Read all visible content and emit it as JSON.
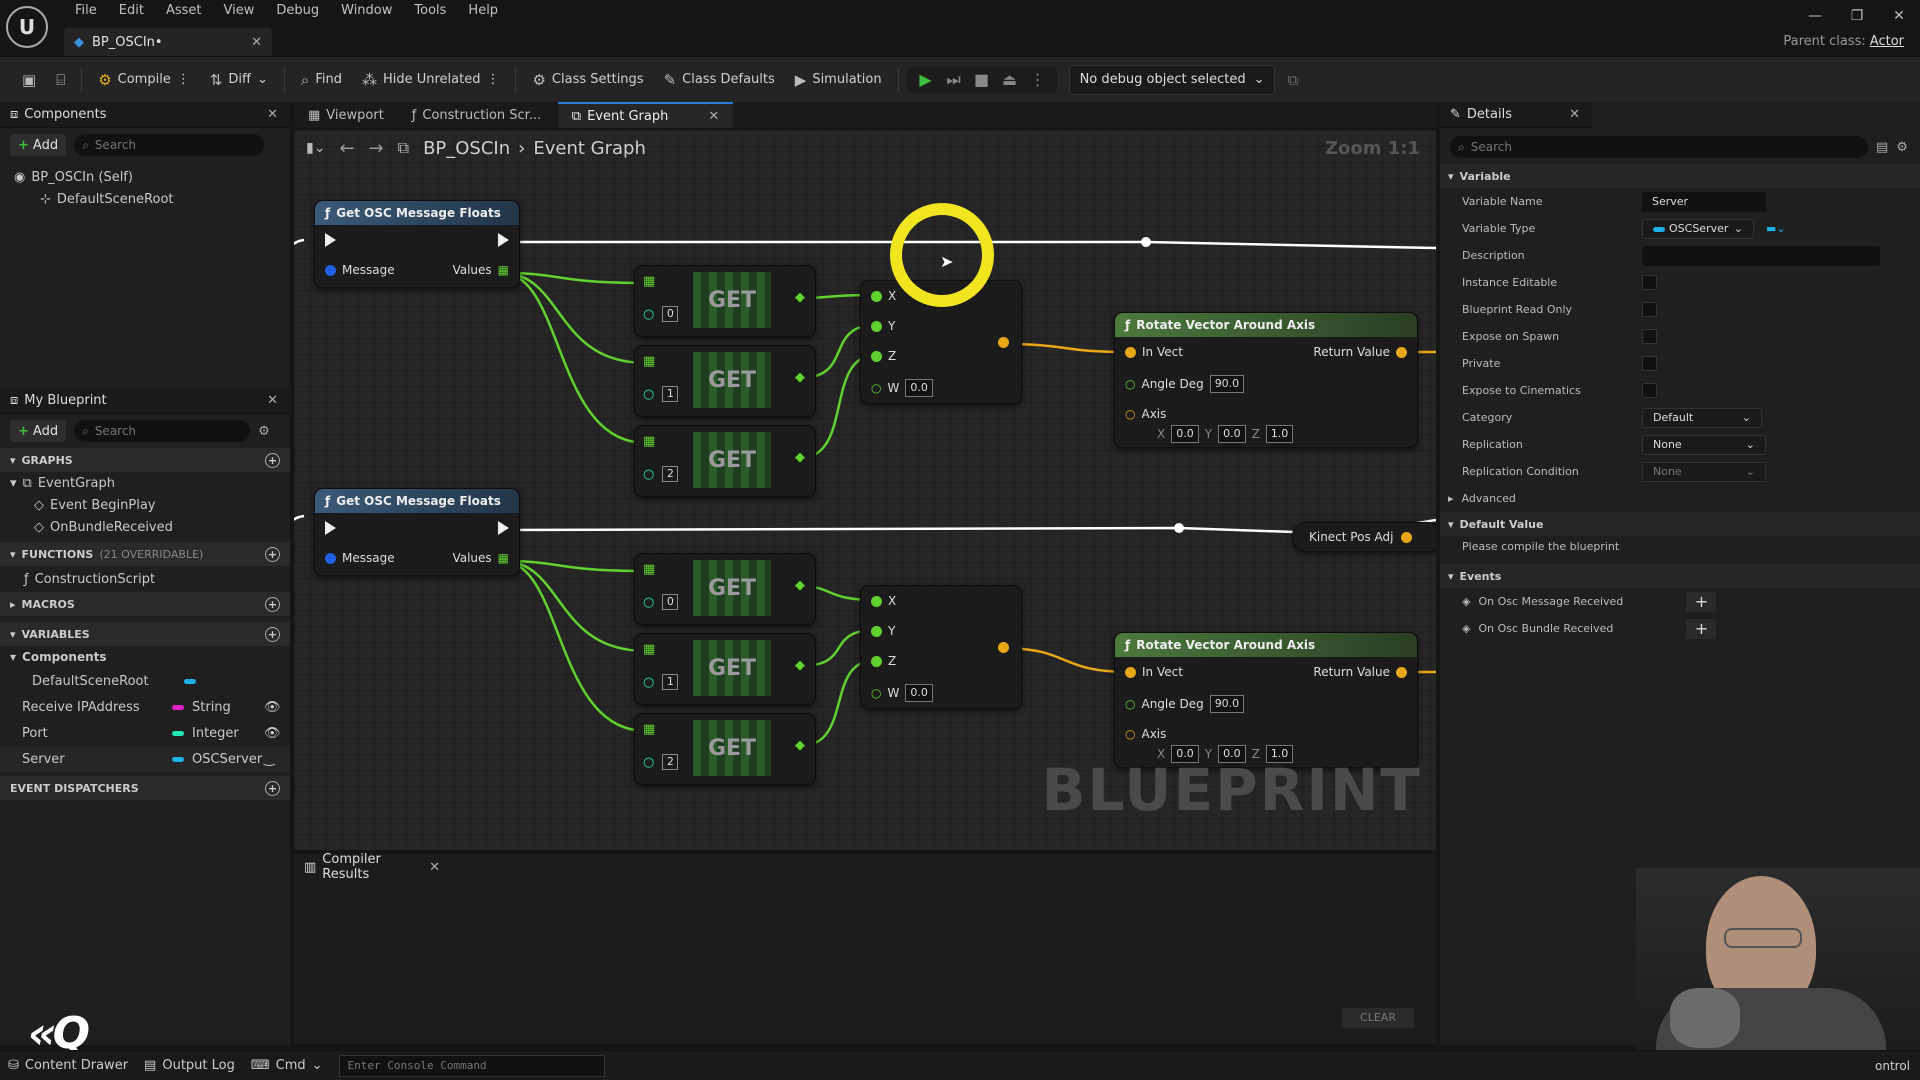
{
  "window": {
    "title": "BP_OSCIn•",
    "parent_label": "Parent class:",
    "parent_value": "Actor",
    "logo": "U"
  },
  "menu": [
    "File",
    "Edit",
    "Asset",
    "View",
    "Debug",
    "Window",
    "Tools",
    "Help"
  ],
  "toolbar": {
    "compile": "Compile",
    "diff": "Diff",
    "find": "Find",
    "hide_unrelated": "Hide Unrelated",
    "class_settings": "Class Settings",
    "class_defaults": "Class Defaults",
    "simulation": "Simulation",
    "debug_object": "No debug object selected"
  },
  "components": {
    "title": "Components",
    "add": "Add",
    "search_placeholder": "Search",
    "root": "BP_OSCIn (Self)",
    "child": "DefaultSceneRoot"
  },
  "my_blueprint": {
    "title": "My Blueprint",
    "add": "Add",
    "search_placeholder": "Search",
    "graphs_label": "GRAPHS",
    "graph": "EventGraph",
    "events": [
      "Event BeginPlay",
      "OnBundleReceived"
    ],
    "functions_label": "FUNCTIONS",
    "functions_sub": "(21 OVERRIDABLE)",
    "function": "ConstructionScript",
    "macros_label": "MACROS",
    "variables_label": "VARIABLES",
    "components_label": "Components",
    "variables": [
      {
        "name": "DefaultSceneRoot",
        "type": "",
        "color": "#1fb0e8"
      },
      {
        "name": "Receive IPAddress",
        "type": "String",
        "color": "#e01fc4"
      },
      {
        "name": "Port",
        "type": "Integer",
        "color": "#1fe8b5"
      },
      {
        "name": "Server",
        "type": "OSCServer",
        "color": "#1fb0e8"
      }
    ],
    "dispatchers_label": "EVENT DISPATCHERS"
  },
  "graph_tabs": [
    "Viewport",
    "Construction Scr...",
    "Event Graph"
  ],
  "breadcrumb": {
    "bp": "BP_OSCIn",
    "graph": "Event Graph",
    "zoom": "Zoom 1:1"
  },
  "nodes": {
    "get_osc": "Get OSC Message Floats",
    "message": "Message",
    "values": "Values",
    "get": "GET",
    "rotate": "Rotate Vector Around Axis",
    "in_vect": "In Vect",
    "return_value": "Return Value",
    "angle_deg": "Angle Deg",
    "angle_val": "90.0",
    "axis": "Axis",
    "axis_x": "0.0",
    "axis_y": "0.0",
    "axis_z": "1.0",
    "x": "X",
    "y": "Y",
    "z": "Z",
    "w": "W",
    "w_val": "0.0",
    "idx0": "0",
    "idx1": "1",
    "idx2": "2",
    "kinect": "Kinect Pos Adj",
    "watermark": "BLUEPRINT"
  },
  "details": {
    "title": "Details",
    "search_placeholder": "Search",
    "variable_section": "Variable",
    "rows": {
      "var_name": "Variable Name",
      "var_name_val": "Server",
      "var_type": "Variable Type",
      "var_type_val": "OSCServer",
      "description": "Description",
      "instance_editable": "Instance Editable",
      "bp_read_only": "Blueprint Read Only",
      "expose_spawn": "Expose on Spawn",
      "private": "Private",
      "expose_cinematics": "Expose to Cinematics",
      "category": "Category",
      "category_val": "Default",
      "replication": "Replication",
      "replication_val": "None",
      "rep_condition": "Replication Condition",
      "rep_condition_val": "None"
    },
    "advanced": "Advanced",
    "default_value": "Default Value",
    "compile_msg": "Please compile the blueprint",
    "events_section": "Events",
    "event1": "On Osc Message Received",
    "event2": "On Osc Bundle Received"
  },
  "compiler": {
    "title": "Compiler Results",
    "clear": "CLEAR"
  },
  "statusbar": {
    "content_drawer": "Content Drawer",
    "output_log": "Output Log",
    "cmd": "Cmd",
    "console_placeholder": "Enter Console Command",
    "right": "ontrol"
  }
}
